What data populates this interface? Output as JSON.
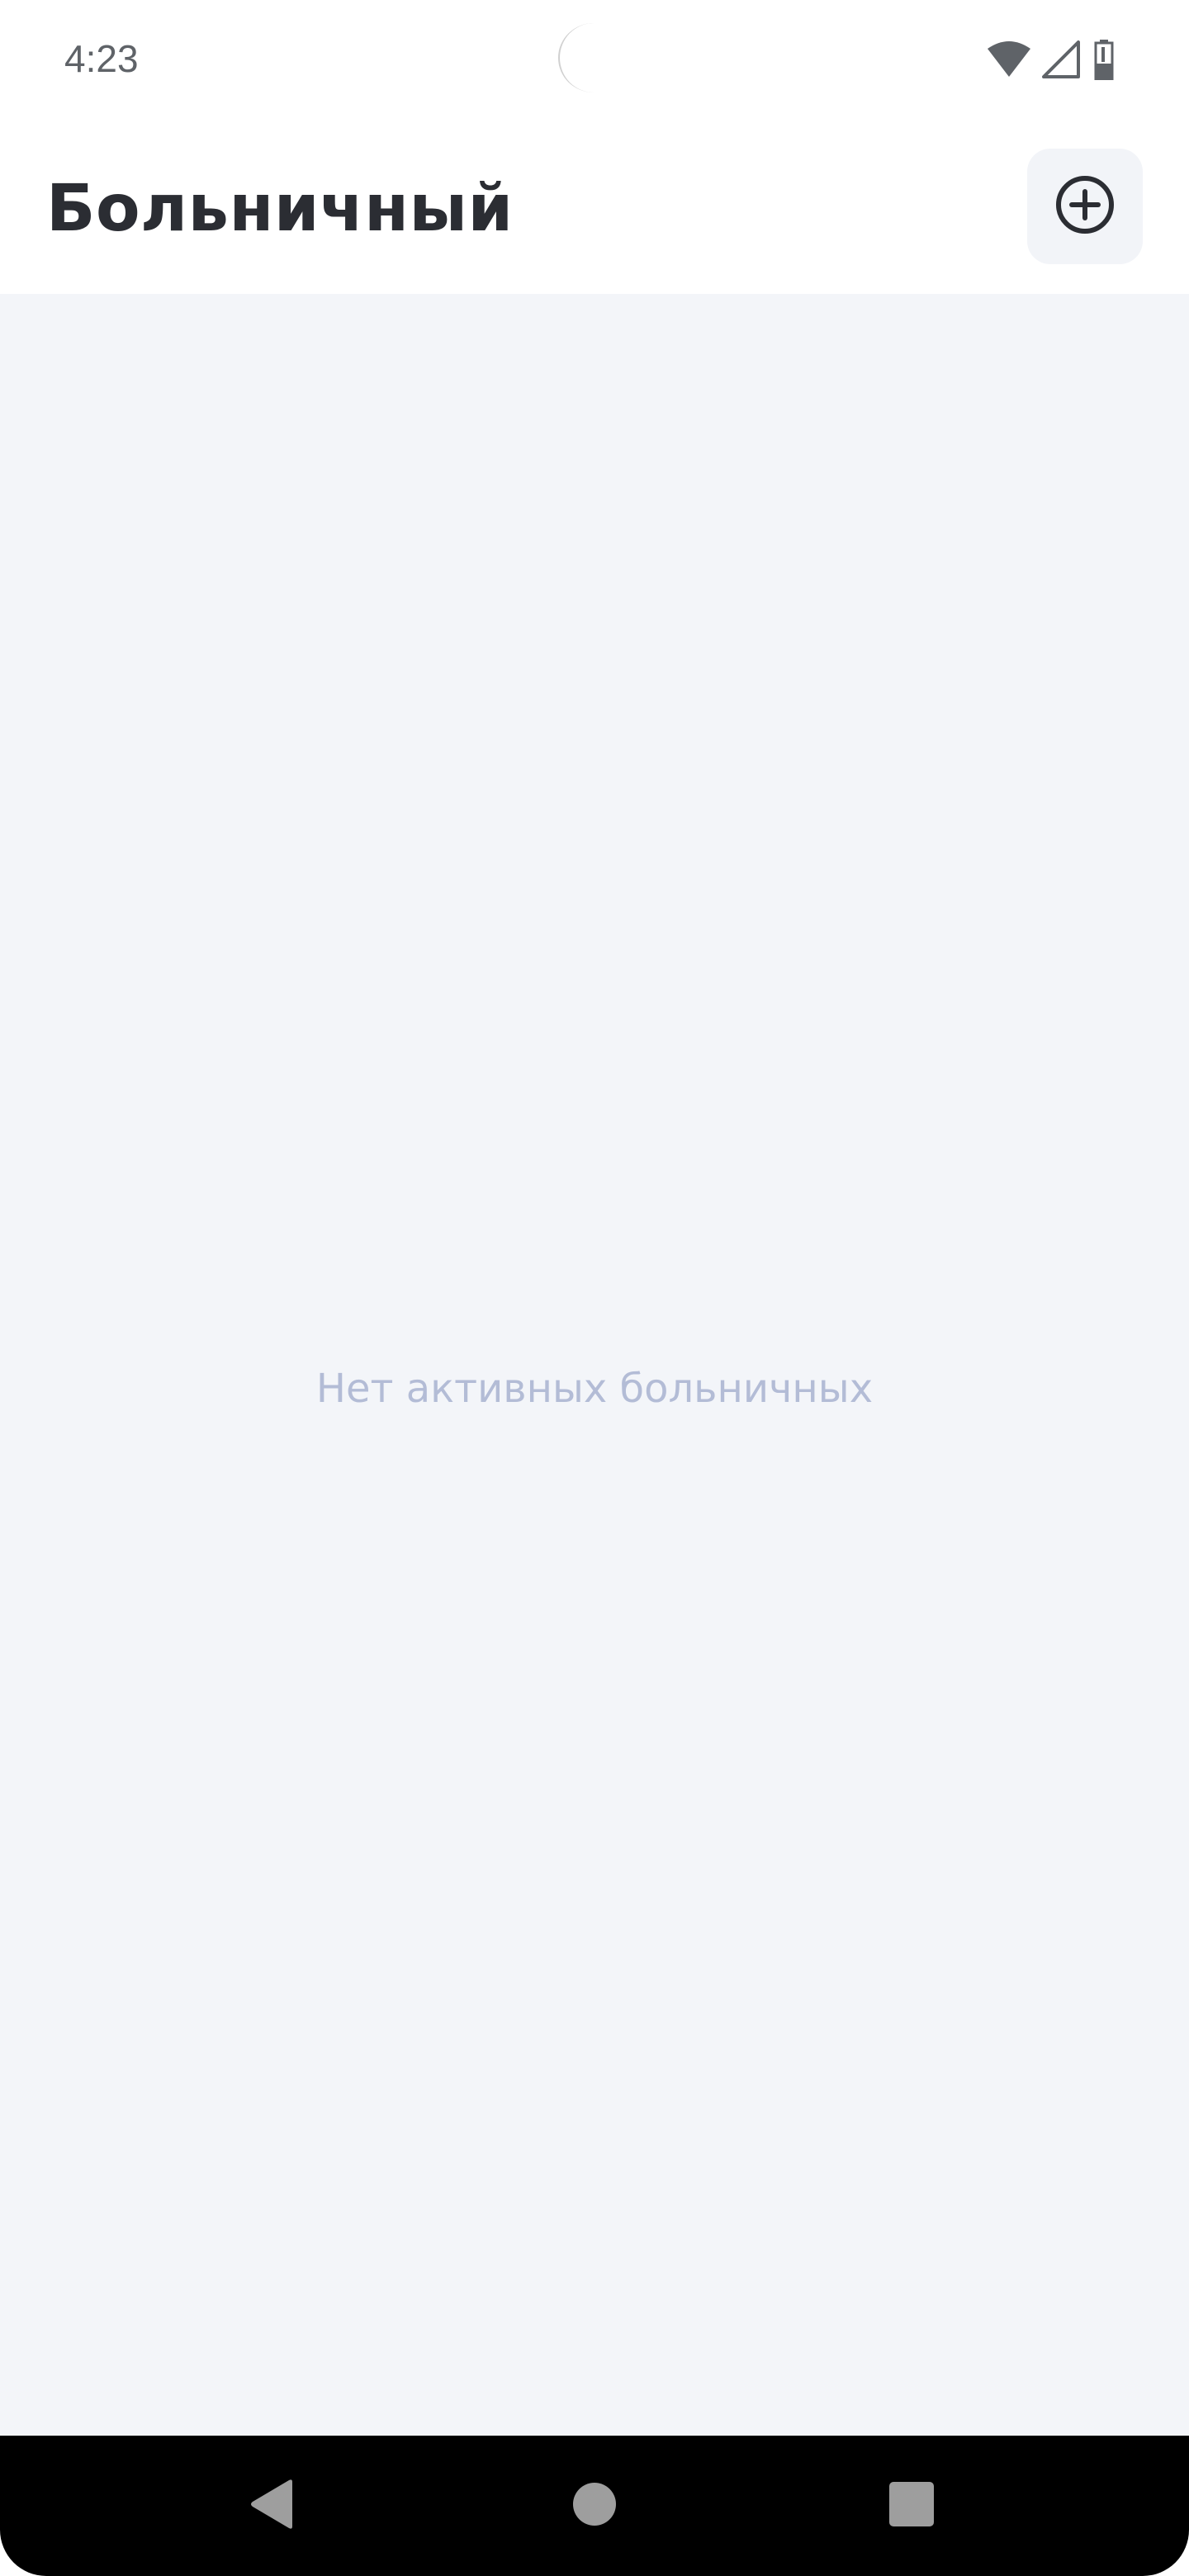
{
  "status_bar": {
    "time": "4:23",
    "icons": [
      "wifi-icon",
      "cellular-signal-icon",
      "battery-icon"
    ]
  },
  "header": {
    "title": "Больничный",
    "add_button_icon": "add-circle-icon"
  },
  "main": {
    "empty_message": "Нет активных больничных"
  },
  "navigation_bar": {
    "buttons": [
      "back-icon",
      "home-icon",
      "recents-icon"
    ]
  },
  "colors": {
    "background": "#f3f5f9",
    "header_background": "#ffffff",
    "title_text": "#2b2d33",
    "empty_text": "#b3bcd6",
    "add_button_background": "#f2f4f8",
    "nav_bar": "#000000"
  }
}
